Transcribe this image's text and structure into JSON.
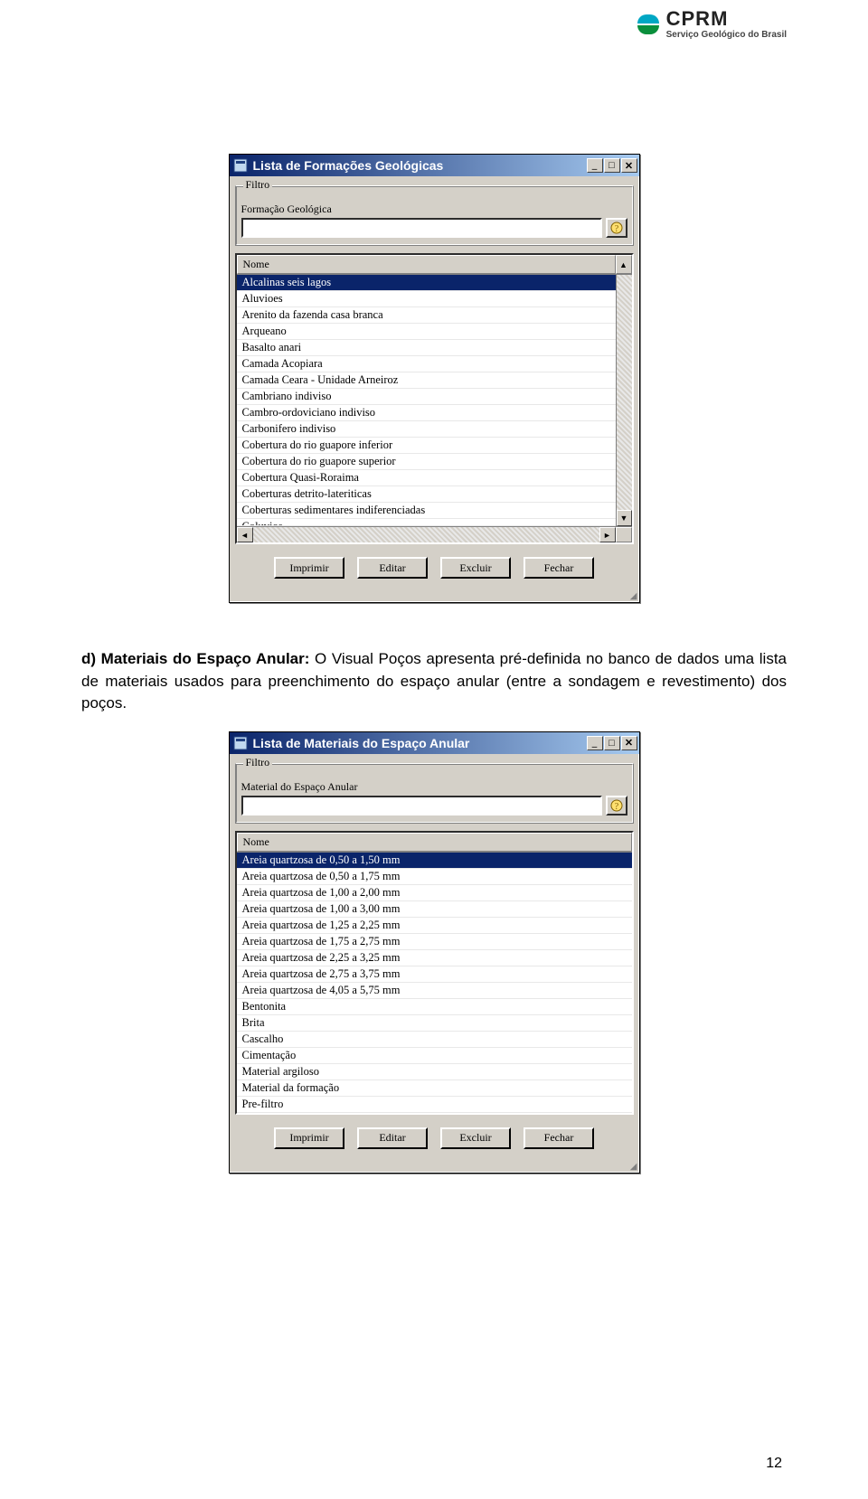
{
  "logo": {
    "name": "CPRM",
    "subtitle": "Serviço Geológico do Brasil"
  },
  "win1": {
    "title": "Lista de Formações Geológicas",
    "filter_legend": "Filtro",
    "filter_label": "Formação Geológica",
    "col_name": "Nome",
    "rows": [
      "Alcalinas seis lagos",
      "Aluvioes",
      "Arenito da fazenda casa branca",
      "Arqueano",
      "Basalto anari",
      "Camada Acopiara",
      "Camada Ceara - Unidade Arneiroz",
      "Cambriano indiviso",
      "Cambro-ordoviciano indiviso",
      "Carbonifero indiviso",
      "Cobertura do rio guapore inferior",
      "Cobertura do rio guapore superior",
      "Cobertura Quasi-Roraima",
      "Coberturas detrito-lateriticas",
      "Coberturas sedimentares indiferenciadas"
    ],
    "cutoff_row": "Coluvios",
    "selected_index": 0,
    "buttons": {
      "print": "Imprimir",
      "edit": "Editar",
      "delete": "Excluir",
      "close": "Fechar"
    }
  },
  "paragraph": {
    "lead": "d) Materiais do Espaço Anular:",
    "rest": " O Visual Poços apresenta pré-definida no banco de dados uma lista de materiais usados para preenchimento do espaço anular (entre a sondagem e revestimento) dos poços."
  },
  "win2": {
    "title": "Lista de Materiais do Espaço Anular",
    "filter_legend": "Filtro",
    "filter_label": "Material do Espaço Anular",
    "col_name": "Nome",
    "rows": [
      "Areia quartzosa de 0,50 a 1,50 mm",
      "Areia quartzosa de 0,50 a 1,75 mm",
      "Areia quartzosa de 1,00 a 2,00 mm",
      "Areia quartzosa de 1,00 a 3,00 mm",
      "Areia quartzosa de 1,25 a 2,25 mm",
      "Areia quartzosa de 1,75 a 2,75 mm",
      "Areia quartzosa de 2,25 a 3,25 mm",
      "Areia quartzosa de 2,75 a 3,75 mm",
      "Areia quartzosa de 4,05 a 5,75 mm",
      "Bentonita",
      "Brita",
      "Cascalho",
      "Cimentação",
      "Material argiloso",
      "Material da formação",
      "Pre-filtro"
    ],
    "selected_index": 0,
    "buttons": {
      "print": "Imprimir",
      "edit": "Editar",
      "delete": "Excluir",
      "close": "Fechar"
    }
  },
  "page_number": "12"
}
